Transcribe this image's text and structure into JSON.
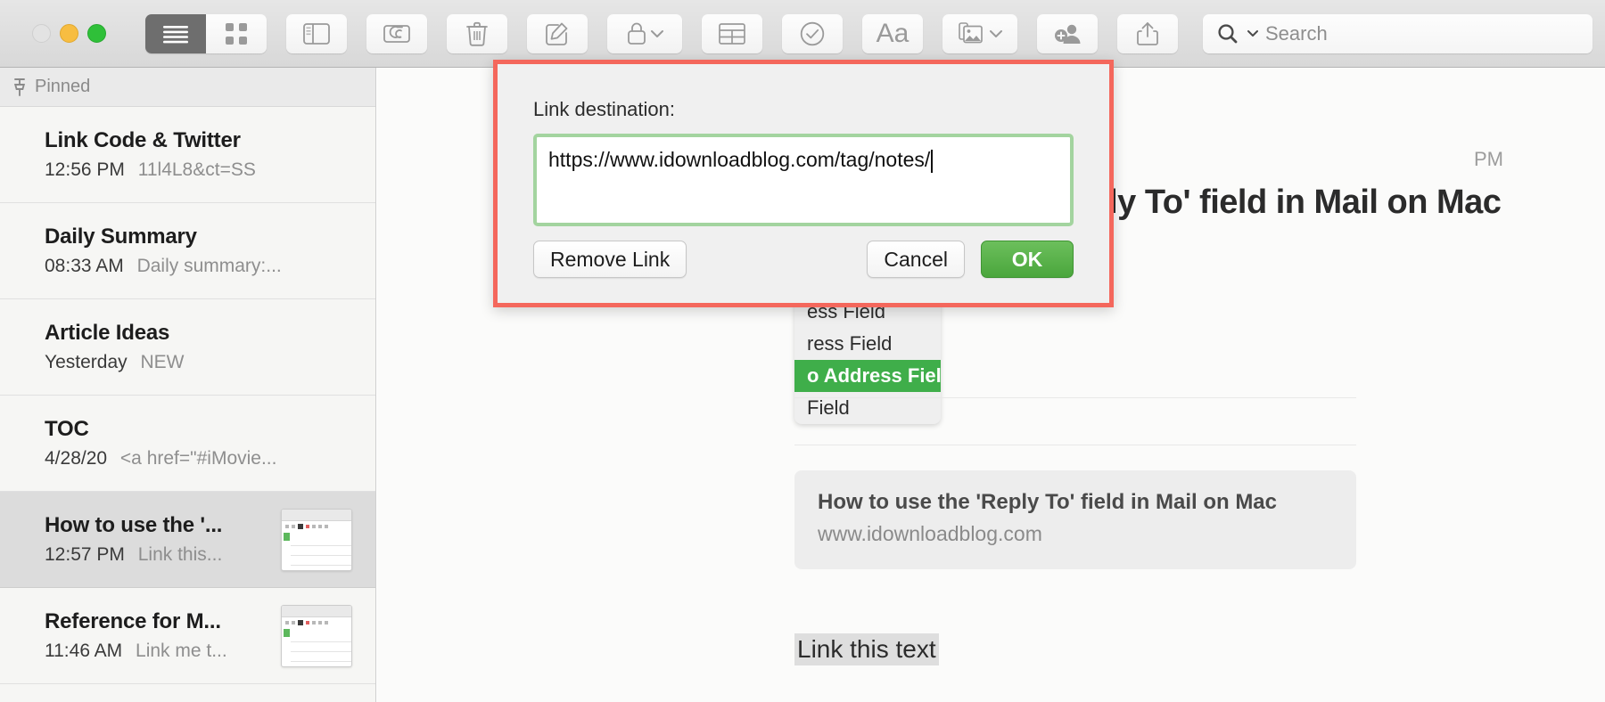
{
  "window": {
    "traffic_lights": [
      "close",
      "minimize",
      "maximize"
    ]
  },
  "toolbar": {
    "view_list_label": "list-view",
    "view_grid_label": "grid-view",
    "buttons": [
      {
        "name": "sidebar-toggle",
        "icon": "sidebar-icon"
      },
      {
        "name": "attachments",
        "icon": "paperclip-icon"
      },
      {
        "name": "delete",
        "icon": "trash-icon"
      },
      {
        "name": "compose",
        "icon": "compose-icon"
      },
      {
        "name": "lock",
        "icon": "lock-icon"
      },
      {
        "name": "table",
        "icon": "table-icon"
      },
      {
        "name": "checklist",
        "icon": "checkmark-circle-icon"
      },
      {
        "name": "format",
        "icon": "aa-icon"
      },
      {
        "name": "media",
        "icon": "photo-icon"
      },
      {
        "name": "add-people",
        "icon": "add-person-icon"
      },
      {
        "name": "share",
        "icon": "share-icon"
      }
    ],
    "format_label": "Aa",
    "search": {
      "placeholder": "Search",
      "value": ""
    }
  },
  "sidebar": {
    "header": {
      "label": "Pinned",
      "icon": "pin-icon"
    },
    "notes": [
      {
        "title": "Link Code & Twitter",
        "time": "12:56 PM",
        "snippet": "11l4L8&ct=SS",
        "selected": false,
        "thumbnail": false
      },
      {
        "title": "Daily Summary",
        "time": "08:33 AM",
        "snippet": "Daily summary:...",
        "selected": false,
        "thumbnail": false
      },
      {
        "title": "Article Ideas",
        "time": "Yesterday",
        "snippet": "NEW",
        "selected": false,
        "thumbnail": false
      },
      {
        "title": "TOC",
        "time": "4/28/20",
        "snippet": "<a href=\"#iMovie...",
        "selected": false,
        "thumbnail": false
      },
      {
        "title": "How to use the '...",
        "time": "12:57 PM",
        "snippet": "Link this...",
        "selected": true,
        "thumbnail": true
      },
      {
        "title": "Reference for M...",
        "time": "11:46 AM",
        "snippet": "Link me t...",
        "selected": false,
        "thumbnail": true
      }
    ]
  },
  "note": {
    "timestamp": "PM",
    "heading": "How to use the 'Reply To' field in Mail on Mac",
    "autocomplete": {
      "icon": "compass-circle-icon",
      "items": [
        {
          "label": "ess Field",
          "highlighted": false
        },
        {
          "label": "ress Field",
          "highlighted": false
        },
        {
          "label": "o Address Field",
          "highlighted": true
        },
        {
          "label": "Field",
          "highlighted": false
        }
      ]
    },
    "link_card": {
      "title": "How to use the 'Reply To' field in Mail on Mac",
      "url": "www.idownloadblog.com"
    },
    "selected_text": "Link this text"
  },
  "dialog": {
    "label": "Link destination:",
    "input_value": "https://www.idownloadblog.com/tag/notes/",
    "input_placeholder": "",
    "remove_label": "Remove Link",
    "cancel_label": "Cancel",
    "ok_label": "OK",
    "highlight_color": "#f4675c",
    "input_focus_color": "#a3d49f",
    "ok_color": "#4aa63c"
  }
}
